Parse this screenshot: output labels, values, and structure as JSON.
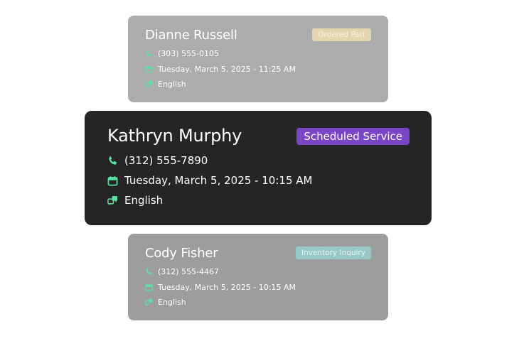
{
  "colors": {
    "icon_green": "#59e3a2",
    "main_card_bg": "#252525",
    "scheduled_badge": "#7946c6"
  },
  "cards": [
    {
      "name": "Dianne Russell",
      "badge": "Ordered Part",
      "phone": "(303) 555-0105",
      "datetime": "Tuesday, March 5, 2025 - 11:25 AM",
      "language": "English"
    },
    {
      "name": "Kathryn Murphy",
      "badge": "Scheduled Service",
      "phone": "(312) 555-7890",
      "datetime": "Tuesday, March 5, 2025 - 10:15 AM",
      "language": "English"
    },
    {
      "name": "Cody Fisher",
      "badge": "Inventory Inquiry",
      "phone": "(312) 555-4467",
      "datetime": "Tuesday, March 5, 2025 - 10:15 AM",
      "language": "English"
    }
  ],
  "icons": {
    "phone": "phone-icon",
    "calendar": "calendar-icon",
    "language": "language-icon"
  }
}
